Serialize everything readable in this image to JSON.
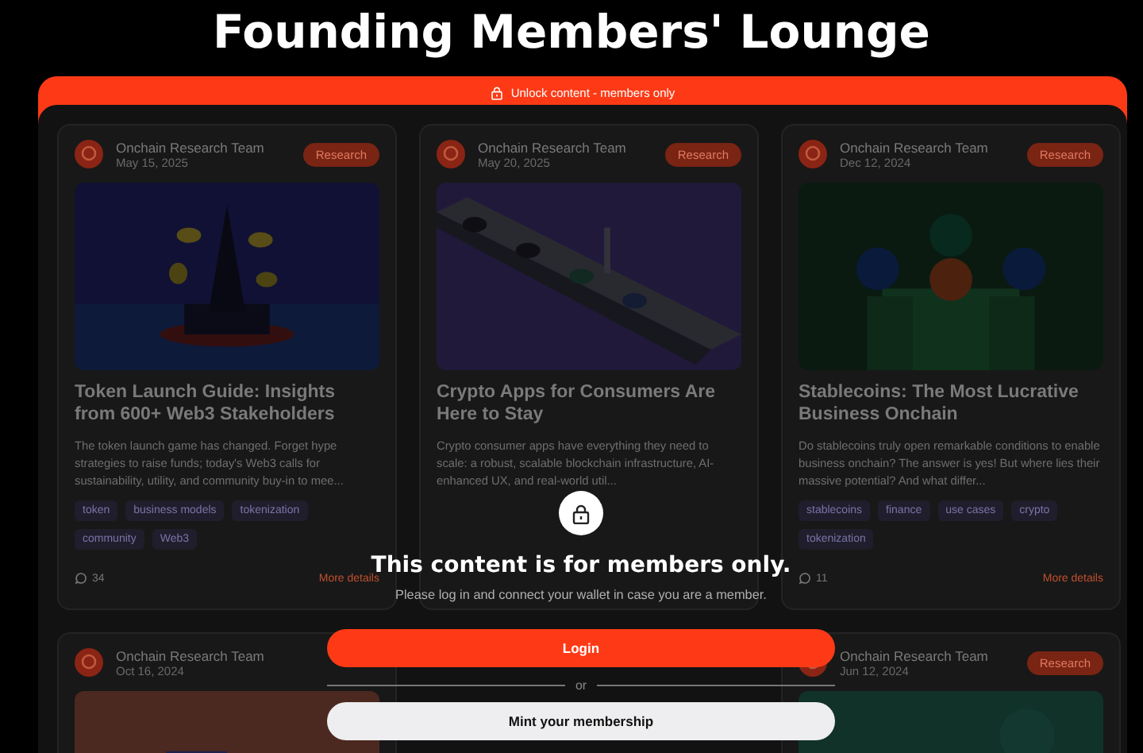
{
  "page_title": "Founding Members' Lounge",
  "banner": {
    "text": "Unlock content - members only"
  },
  "posts": [
    {
      "author": "Onchain Research Team",
      "date": "May 15, 2025",
      "category": "Research",
      "title": "Token Launch Guide: Insights from 600+ Web3 Stakeholders",
      "excerpt": "The token launch game has changed. Forget hype strategies to raise funds; today's Web3 calls for sustainability, utility, and community buy-in to mee...",
      "tags": [
        "token",
        "business models",
        "tokenization",
        "community",
        "Web3"
      ],
      "comments": "34",
      "link": "More details"
    },
    {
      "author": "Onchain Research Team",
      "date": "May 20, 2025",
      "category": "Research",
      "title": "Crypto Apps for Consumers Are Here to Stay",
      "excerpt": "Crypto consumer apps have everything they need to scale: a robust, scalable blockchain infrastructure, AI-enhanced UX, and real-world util..."
    },
    {
      "author": "Onchain Research Team",
      "date": "Dec 12, 2024",
      "category": "Research",
      "title": "Stablecoins: The Most Lucrative Business Onchain",
      "excerpt": "Do stablecoins truly open remarkable conditions to enable business onchain? The answer is yes! But where lies their massive potential? And what differ...",
      "tags": [
        "stablecoins",
        "finance",
        "use cases",
        "crypto",
        "tokenization"
      ],
      "comments": "11",
      "link": "More details"
    },
    {
      "author": "Onchain Research Team",
      "date": "Oct 16, 2024"
    },
    {
      "author": "Onchain Research Team",
      "date": "Jun 12, 2024",
      "category": "Research"
    }
  ],
  "gate": {
    "heading": "This content is for members only.",
    "message": "Please log in and connect your wallet in case you are a member.",
    "primary_button": "Login",
    "divider": "or",
    "secondary_button": "Mint your membership"
  }
}
